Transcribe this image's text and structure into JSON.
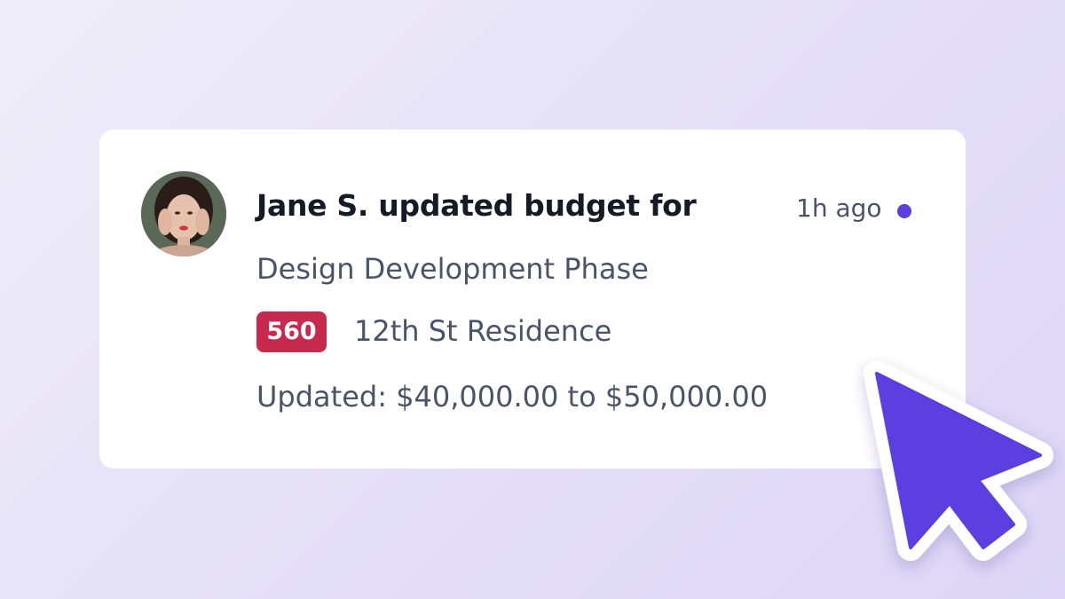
{
  "notification": {
    "headline": "Jane S. updated budget for",
    "time": "1h ago",
    "phase": "Design Development Phase",
    "project_number": "560",
    "project_name": "12th St Residence",
    "change": "Updated: $40,000.00 to $50,000.00",
    "unread": true
  },
  "colors": {
    "accent": "#5b3fe0",
    "badge": "#c72a4e",
    "headline_text": "#141a26",
    "body_text": "#4a5468"
  },
  "icons": {
    "cursor": "mouse-pointer-icon",
    "avatar": "user-avatar-photo"
  }
}
